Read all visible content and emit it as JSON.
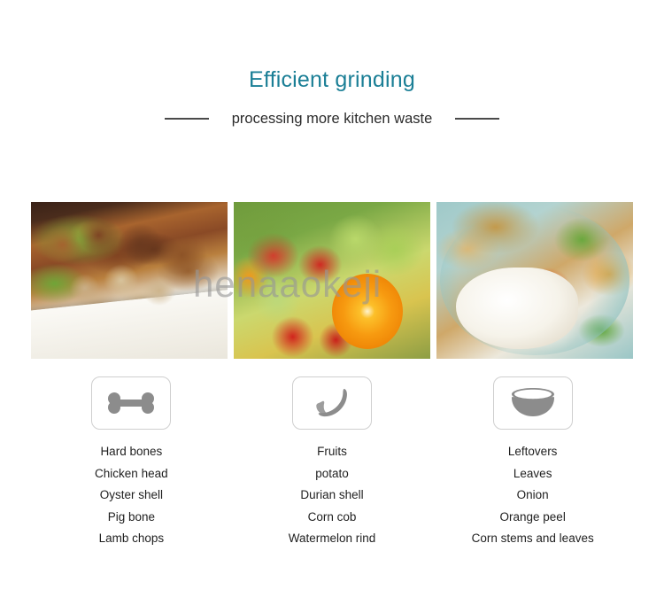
{
  "header": {
    "title": "Efficient grinding",
    "subtitle": "processing more kitchen waste",
    "rule_left": "divider-rule",
    "rule_right": "divider-rule"
  },
  "watermark": {
    "text": "henaaokeji"
  },
  "gallery": {
    "photos": [
      {
        "alt": "braised bones and ribs on a white plate",
        "icon": "bone-icon"
      },
      {
        "alt": "assorted fresh fruit - apples, grapes, strawberries, orange",
        "icon": "banana-icon"
      },
      {
        "alt": "leftover rice, noodles and vegetables on a teal plate",
        "icon": "bowl-icon"
      }
    ]
  },
  "categories": [
    {
      "icon": "bone-icon",
      "items": [
        "Hard bones",
        "Chicken head",
        "Oyster shell",
        "Pig bone",
        "Lamb chops"
      ]
    },
    {
      "icon": "banana-icon",
      "items": [
        "Fruits",
        "potato",
        "Durian shell",
        "Corn cob",
        "Watermelon rind"
      ]
    },
    {
      "icon": "bowl-icon",
      "items": [
        "Leftovers",
        "Leaves",
        "Onion",
        "Orange peel",
        "Corn stems and leaves"
      ]
    }
  ],
  "colors": {
    "title": "#1b7f96",
    "text": "#1f1f1f",
    "rule": "#4a4a4a",
    "icon_gray": "#8c8c8c",
    "icon_border": "#cfcfcf",
    "background": "#ffffff"
  }
}
